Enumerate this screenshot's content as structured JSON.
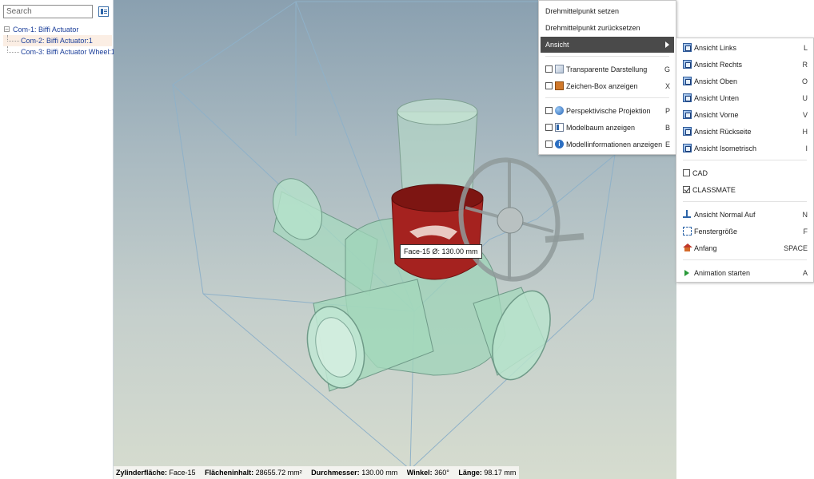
{
  "tree_panel": {
    "search_placeholder": "Search",
    "nodes": [
      {
        "label": "Com-1: Biffi Actuator",
        "level": 0
      },
      {
        "label": "Com-2: Biffi Actuator:1",
        "level": 1
      },
      {
        "label": "Com-3: Biffi Actuator Wheel:1",
        "level": 1
      }
    ]
  },
  "viewport": {
    "face_label": "Face-15 Ø: 130.00 mm",
    "status": {
      "surface_label": "Zylinderfläche:",
      "surface_value": "Face-15",
      "area_label": "Flächeninhalt:",
      "area_value": "28655.72 mm²",
      "diameter_label": "Durchmesser:",
      "diameter_value": "130.00 mm",
      "angle_label": "Winkel:",
      "angle_value": "360°",
      "length_label": "Länge:",
      "length_value": "98.17 mm"
    }
  },
  "context_menu": {
    "set_pivot": "Drehmittelpunkt setzen",
    "reset_pivot": "Drehmittelpunkt zurücksetzen",
    "view": "Ansicht",
    "transparent": {
      "label": "Transparente Darstellung",
      "key": "G"
    },
    "draw_box": {
      "label": "Zeichen-Box anzeigen",
      "key": "X"
    },
    "perspective": {
      "label": "Perspektivische Projektion",
      "key": "P"
    },
    "model_tree": {
      "label": "Modelbaum anzeigen",
      "key": "B"
    },
    "model_info": {
      "label": "Modellinformationen anzeigen",
      "key": "E"
    }
  },
  "view_submenu": {
    "left": {
      "label": "Ansicht Links",
      "key": "L"
    },
    "right": {
      "label": "Ansicht Rechts",
      "key": "R"
    },
    "top": {
      "label": "Ansicht Oben",
      "key": "O"
    },
    "bottom": {
      "label": "Ansicht Unten",
      "key": "U"
    },
    "front": {
      "label": "Ansicht Vorne",
      "key": "V"
    },
    "back": {
      "label": "Ansicht Rückseite",
      "key": "H"
    },
    "iso": {
      "label": "Ansicht Isometrisch",
      "key": "I"
    },
    "cad": {
      "label": "CAD",
      "checked": false
    },
    "classmate": {
      "label": "CLASSMATE",
      "checked": true
    },
    "normal": {
      "label": "Ansicht Normal Auf",
      "key": "N"
    },
    "fit": {
      "label": "Fenstergröße",
      "key": "F"
    },
    "home": {
      "label": "Anfang",
      "key": "SPACE"
    },
    "animate": {
      "label": "Animation starten",
      "key": "A"
    }
  }
}
